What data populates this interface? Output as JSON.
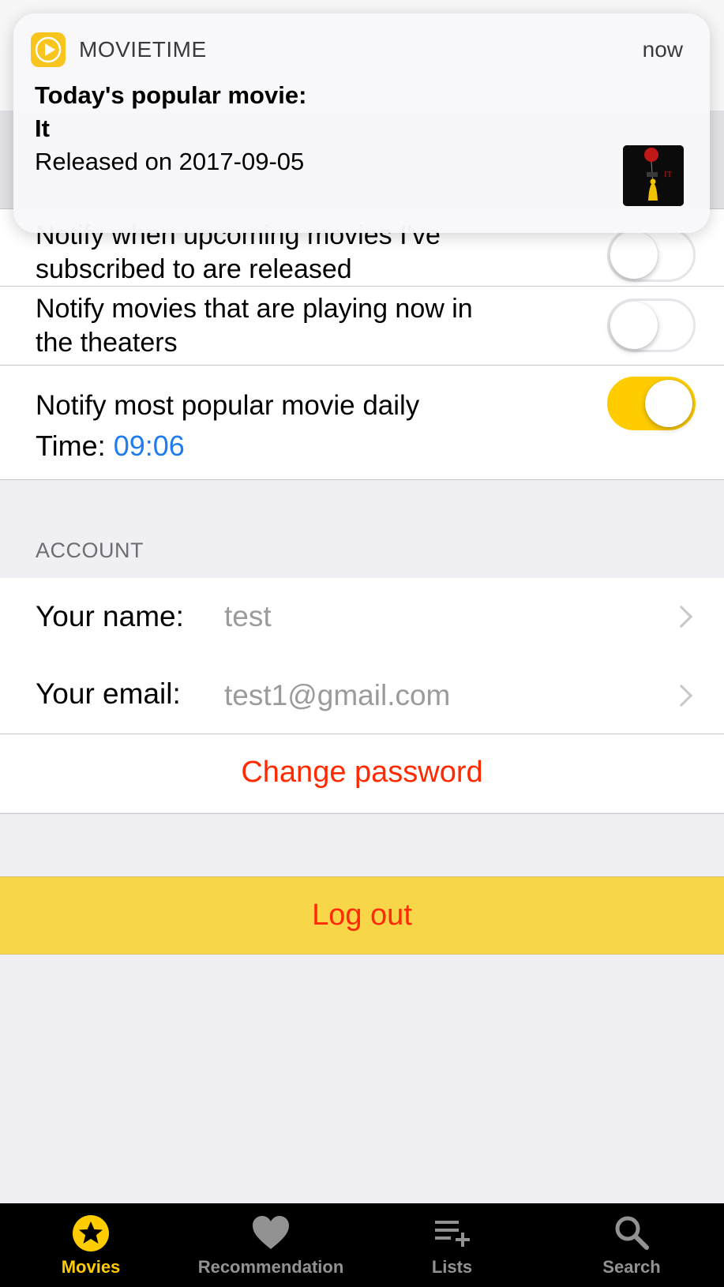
{
  "notification": {
    "app_name": "MOVIETIME",
    "time": "now",
    "title_line1": "Today's popular movie:",
    "title_line2": "It",
    "body": "Released on 2017-09-05",
    "thumb_text": "IT"
  },
  "settings": {
    "notify_upcoming_line1": "Notify when upcoming movies I've",
    "notify_upcoming_line2": "subscribed to are released",
    "notify_upcoming_on": false,
    "notify_playing_line1": "Notify movies that are playing now in",
    "notify_playing_line2": "the theaters",
    "notify_playing_on": false,
    "notify_popular_label": "Notify most popular movie daily",
    "notify_popular_on": true,
    "time_label": "Time:",
    "time_value": "09:06"
  },
  "account": {
    "header": "ACCOUNT",
    "name_label": "Your name:",
    "name_value": "test",
    "email_label": "Your email:",
    "email_value": "test1@gmail.com",
    "change_password": "Change password"
  },
  "logout": "Log out",
  "tabs": [
    {
      "label": "Movies",
      "icon": "star-icon",
      "active": true
    },
    {
      "label": "Recommendation",
      "icon": "heart-icon",
      "active": false
    },
    {
      "label": "Lists",
      "icon": "list-add-icon",
      "active": false
    },
    {
      "label": "Search",
      "icon": "search-icon",
      "active": false
    }
  ],
  "colors": {
    "accent": "#ffcc00",
    "link_blue": "#1e7cf0",
    "destructive_red": "#ff2a00",
    "logout_bg": "#f8d64a"
  }
}
